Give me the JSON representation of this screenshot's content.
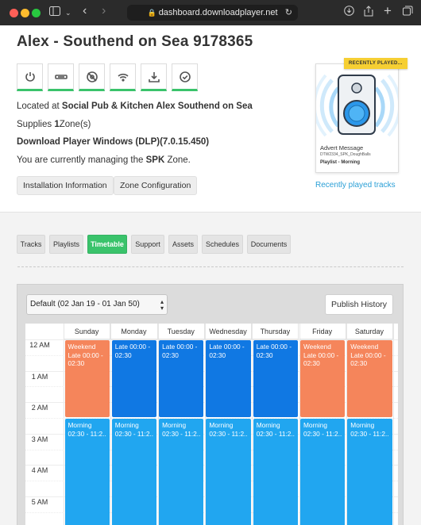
{
  "browser": {
    "url": "dashboard.downloadplayer.net"
  },
  "page": {
    "title": "Alex - Southend on Sea 9178365",
    "location_prefix": "Located at",
    "location_name": "Social Pub & Kitchen Alex Southend on Sea",
    "zones_prefix": "Supplies",
    "zones_count": "1",
    "zones_suffix": "Zone(s)",
    "player_version": "Download Player Windows (DLP)(7.0.15.450)",
    "managing_prefix": "You are currently managing the",
    "managing_zone": "SPK",
    "managing_suffix": "Zone.",
    "buttons": {
      "installation": "Installation Information",
      "zone_config": "Zone Configuration"
    },
    "status_icons": [
      "power-icon",
      "screen-icon",
      "disk-icon",
      "wifi-icon",
      "download-icon",
      "check-circle-icon"
    ],
    "status_color": "#3ac36b"
  },
  "recent": {
    "badge": "RECENTLY PLAYED...",
    "type": "Advert Message",
    "file": "DTW2334_SPK_DoughBalls",
    "playlist": "Playlist - Morning",
    "link": "Recently played tracks"
  },
  "tabs": [
    "Tracks",
    "Playlists",
    "Timetable",
    "Support",
    "Assets",
    "Schedules",
    "Documents"
  ],
  "active_tab": "Timetable",
  "timetable": {
    "schedule_select": "Default (02 Jan 19 - 01 Jan 50)",
    "publish_label": "Publish History",
    "days": [
      "Sunday",
      "Monday",
      "Tuesday",
      "Wednesday",
      "Thursday",
      "Friday",
      "Saturday"
    ],
    "hours": [
      "12 AM",
      "1 AM",
      "2 AM",
      "3 AM",
      "4 AM",
      "5 AM"
    ],
    "colors": {
      "weekend": "#f5855b",
      "late": "#1078e3",
      "morning": "#21a6f0"
    },
    "events": [
      {
        "day": "Sunday",
        "kind": "weekend",
        "line1": "Weekend",
        "line2": "Late 00:00 -",
        "line3": "02:30"
      },
      {
        "day": "Monday",
        "kind": "late",
        "line1": "Late 00:00 -",
        "line2": "02:30",
        "line3": ""
      },
      {
        "day": "Tuesday",
        "kind": "late",
        "line1": "Late 00:00 -",
        "line2": "02:30",
        "line3": ""
      },
      {
        "day": "Wednesday",
        "kind": "late",
        "line1": "Late 00:00 -",
        "line2": "02:30",
        "line3": ""
      },
      {
        "day": "Thursday",
        "kind": "late",
        "line1": "Late 00:00 -",
        "line2": "02:30",
        "line3": ""
      },
      {
        "day": "Friday",
        "kind": "weekend",
        "line1": "Weekend",
        "line2": "Late 00:00 -",
        "line3": "02:30"
      },
      {
        "day": "Saturday",
        "kind": "weekend",
        "line1": "Weekend",
        "line2": "Late 00:00 -",
        "line3": "02:30"
      },
      {
        "day": "Sunday",
        "kind": "morning",
        "line1": "Morning",
        "line2": "02:30 - 11:2..",
        "line3": ""
      },
      {
        "day": "Monday",
        "kind": "morning",
        "line1": "Morning",
        "line2": "02:30 - 11:2..",
        "line3": ""
      },
      {
        "day": "Tuesday",
        "kind": "morning",
        "line1": "Morning",
        "line2": "02:30 - 11:2..",
        "line3": ""
      },
      {
        "day": "Wednesday",
        "kind": "morning",
        "line1": "Morning",
        "line2": "02:30 - 11:2..",
        "line3": ""
      },
      {
        "day": "Thursday",
        "kind": "morning",
        "line1": "Morning",
        "line2": "02:30 - 11:2..",
        "line3": ""
      },
      {
        "day": "Friday",
        "kind": "morning",
        "line1": "Morning",
        "line2": "02:30 - 11:2..",
        "line3": ""
      },
      {
        "day": "Saturday",
        "kind": "morning",
        "line1": "Morning",
        "line2": "02:30 - 11:2..",
        "line3": ""
      }
    ]
  }
}
